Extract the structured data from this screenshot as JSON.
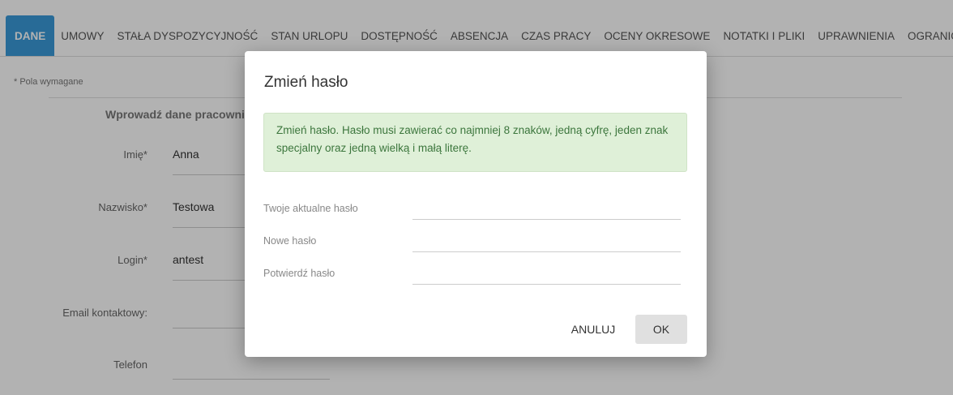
{
  "tabs": [
    {
      "label": "DANE",
      "active": true
    },
    {
      "label": "UMOWY"
    },
    {
      "label": "STAŁA DYSPOZYCYJNOŚĆ"
    },
    {
      "label": "STAN URLOPU"
    },
    {
      "label": "DOSTĘPNOŚĆ"
    },
    {
      "label": "ABSENCJA"
    },
    {
      "label": "CZAS PRACY"
    },
    {
      "label": "OCENY OKRESOWE"
    },
    {
      "label": "NOTATKI I PLIKI"
    },
    {
      "label": "UPRAWNIENIA"
    },
    {
      "label": "OGRANICZENIA"
    }
  ],
  "form": {
    "required_note": "* Pola wymagane",
    "section_title": "Wprowadź dane pracownika",
    "fields": [
      {
        "label": "Imię*",
        "value": "Anna"
      },
      {
        "label": "Nazwisko*",
        "value": "Testowa"
      },
      {
        "label": "Login*",
        "value": "antest"
      },
      {
        "label": "Email kontaktowy:",
        "value": ""
      },
      {
        "label": "Telefon",
        "value": ""
      }
    ]
  },
  "modal": {
    "title": "Zmień hasło",
    "alert": "Zmień hasło. Hasło musi zawierać co najmniej 8 znaków, jedną cyfrę, jeden znak specjalny oraz jedną wielką i małą literę.",
    "fields": [
      {
        "label": "Twoje aktualne hasło",
        "value": ""
      },
      {
        "label": "Nowe hasło",
        "value": ""
      },
      {
        "label": "Potwierdź hasło",
        "value": ""
      }
    ],
    "cancel_label": "ANULUJ",
    "ok_label": "OK"
  },
  "colors": {
    "tab_active": "#3a9ad9",
    "alert_bg": "#dff0d8",
    "alert_text": "#3c763d",
    "ok_button_bg": "#e0e0e0"
  }
}
